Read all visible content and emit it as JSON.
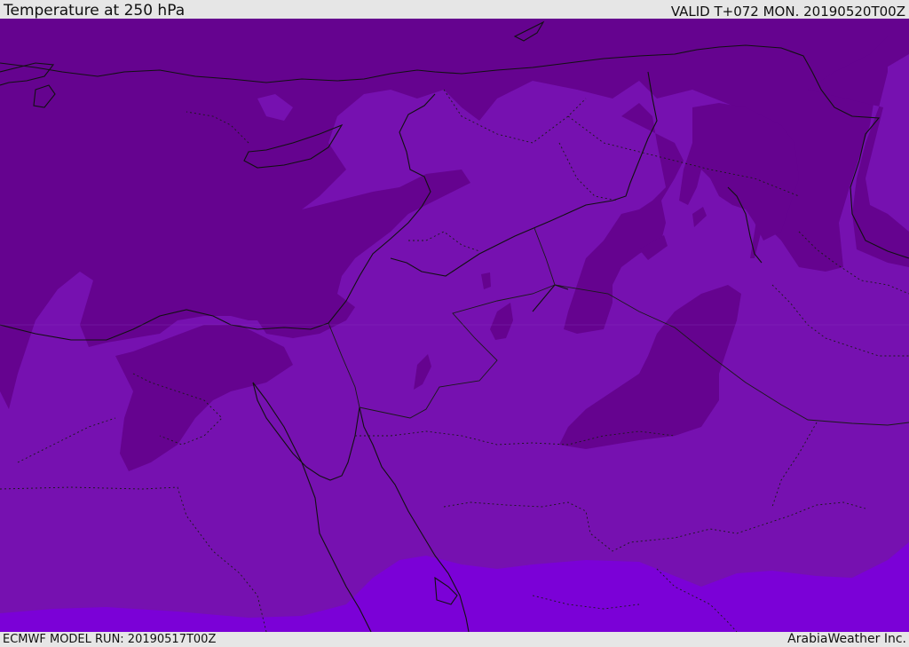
{
  "header": {
    "title": "Temperature at 250 hPa",
    "valid": "VALID T+072 MON. 20190520T00Z"
  },
  "footer": {
    "model_run": "ECMWF MODEL RUN: 20190517T00Z",
    "credit": "ArabiaWeather Inc."
  },
  "map": {
    "colors": {
      "cold_band": "#65038f",
      "mid_band": "#7611b0",
      "warm_band": "#7b01d7",
      "coastline": "#111111",
      "borders": "#1a1a1a"
    }
  }
}
